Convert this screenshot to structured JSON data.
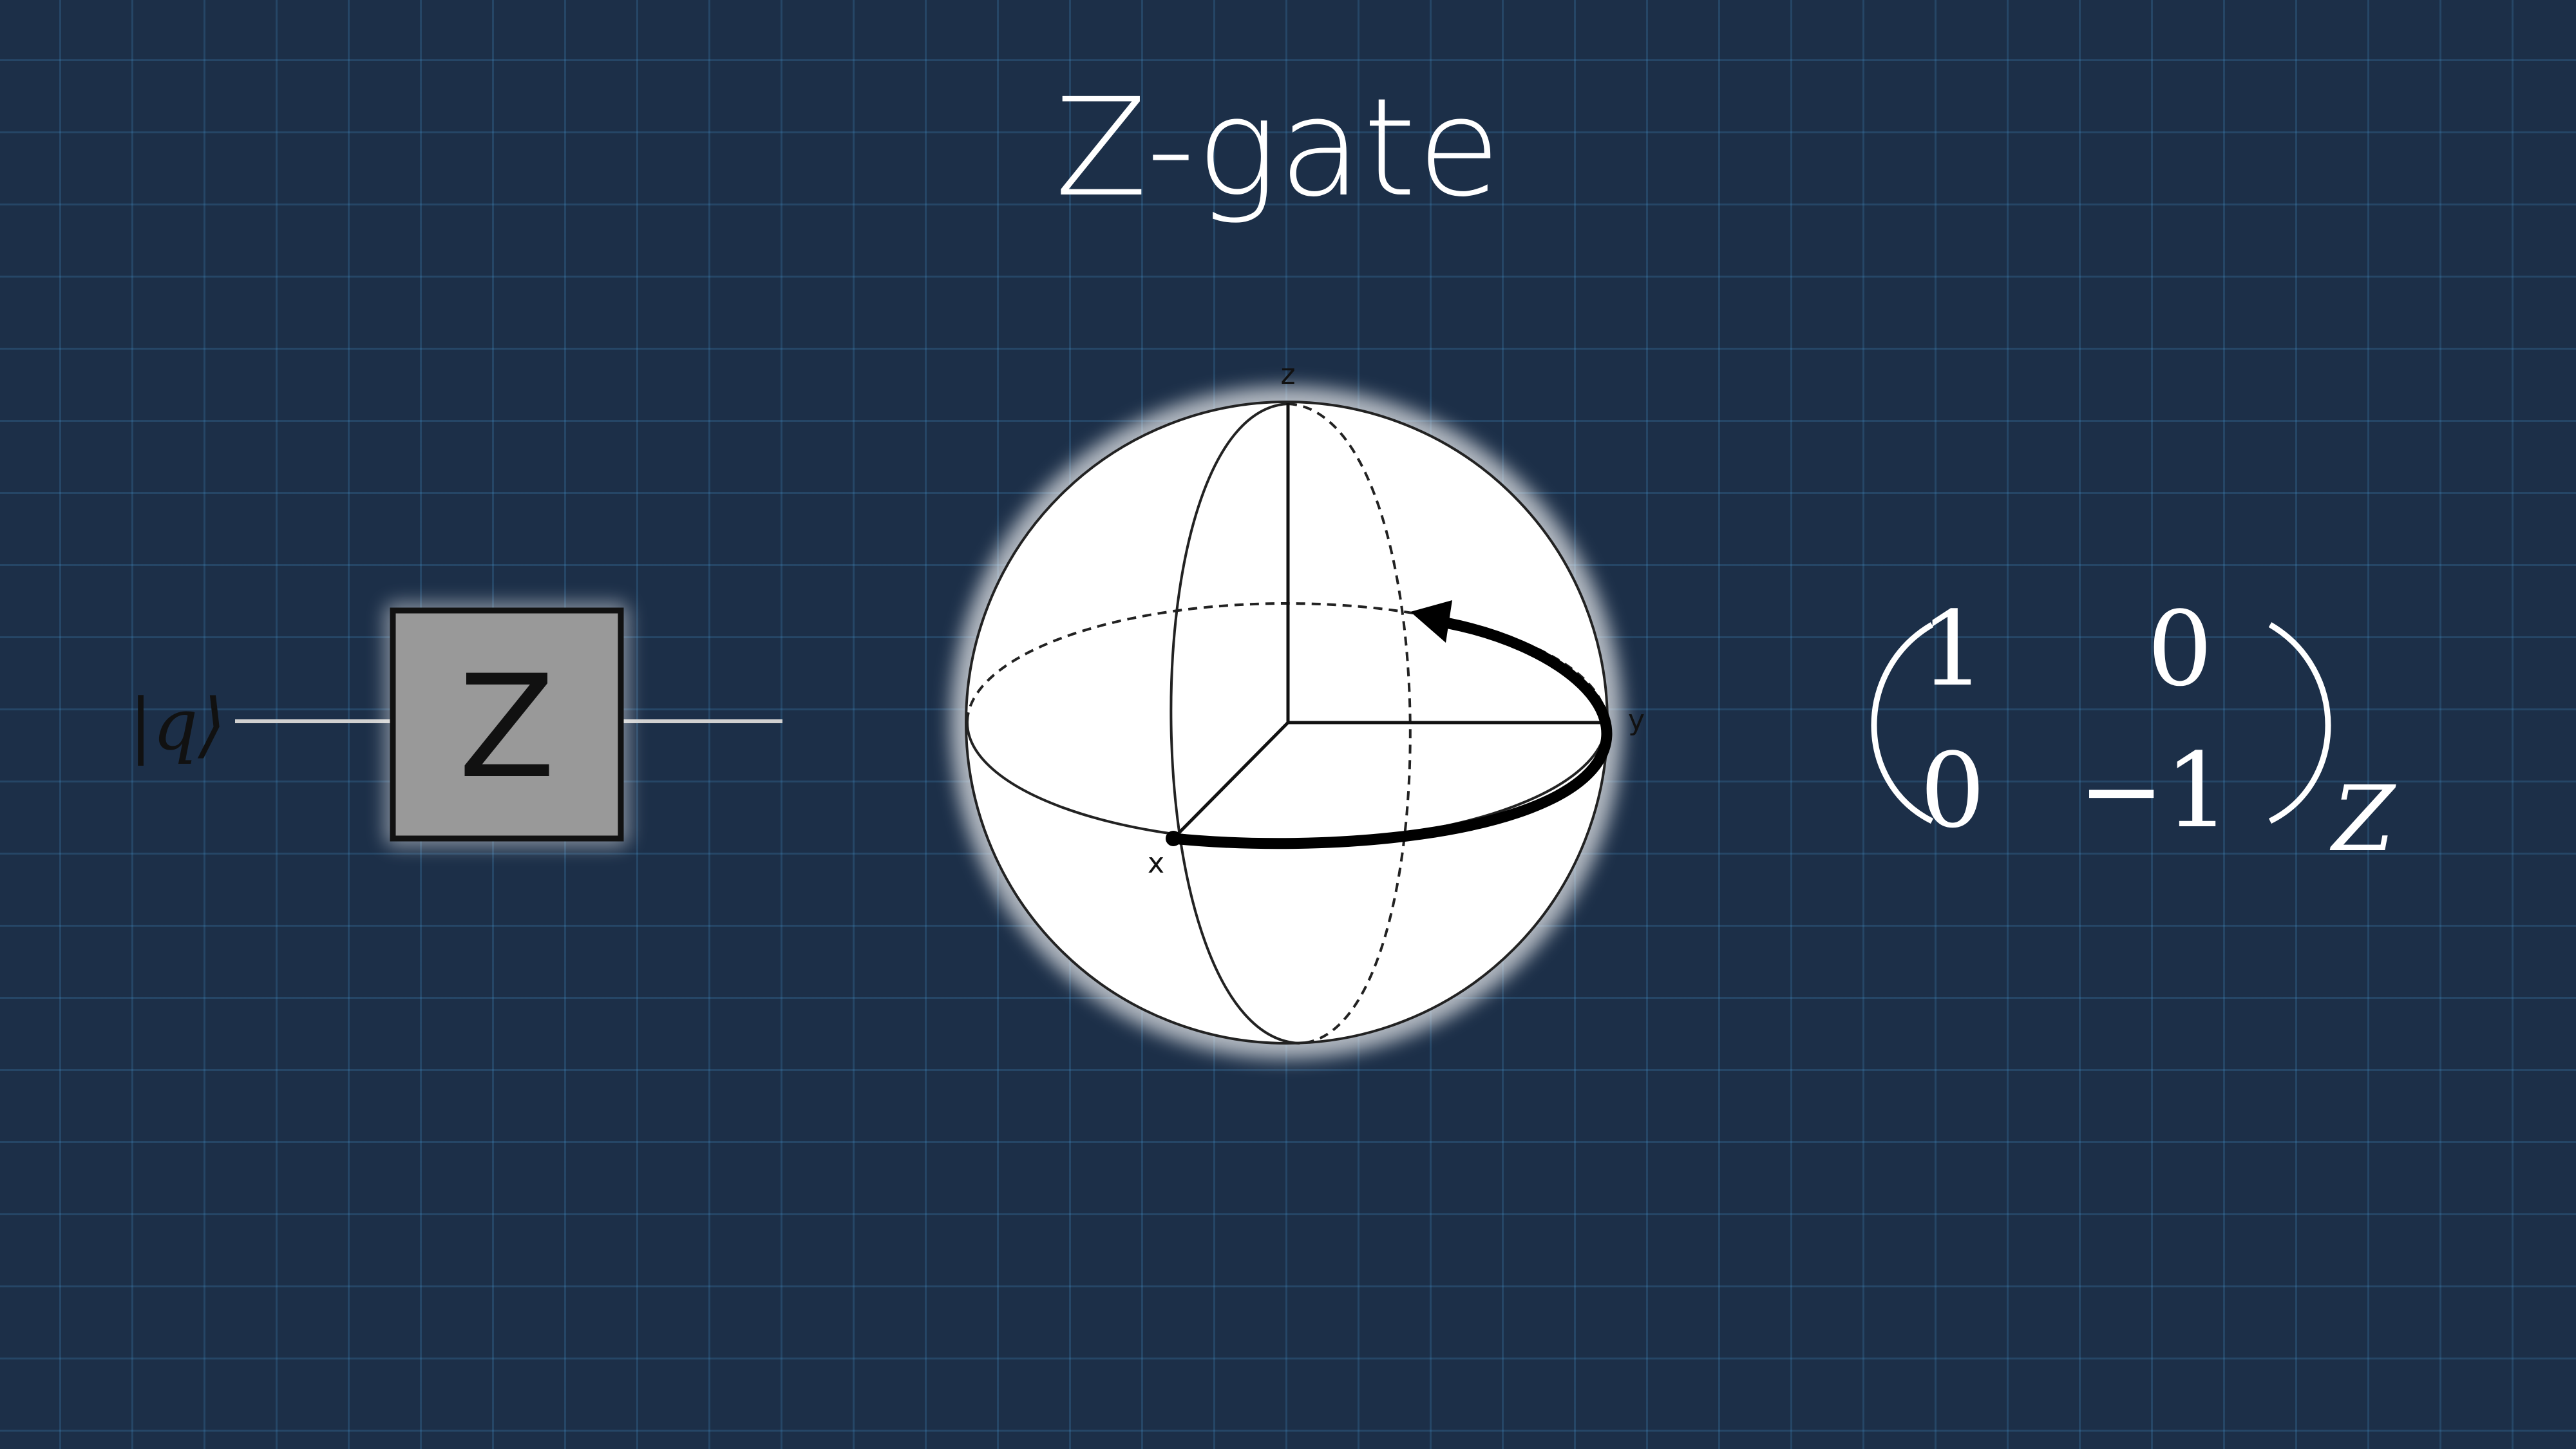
{
  "slide": {
    "title": "Z-gate",
    "background_color": "#1c2f48",
    "grid_color": "#2d5a85"
  },
  "circuit": {
    "input_label": "|q⟩",
    "gate_label": "Z",
    "gate_fill": "#999999"
  },
  "bloch_sphere": {
    "axis_labels": {
      "z": "z",
      "y": "y",
      "x": "x"
    },
    "rotation_arrow_icon": "curved-arrow-icon"
  },
  "matrix": {
    "entries": [
      [
        "1",
        "0"
      ],
      [
        "0",
        "−1"
      ]
    ],
    "subscript": "Z"
  }
}
